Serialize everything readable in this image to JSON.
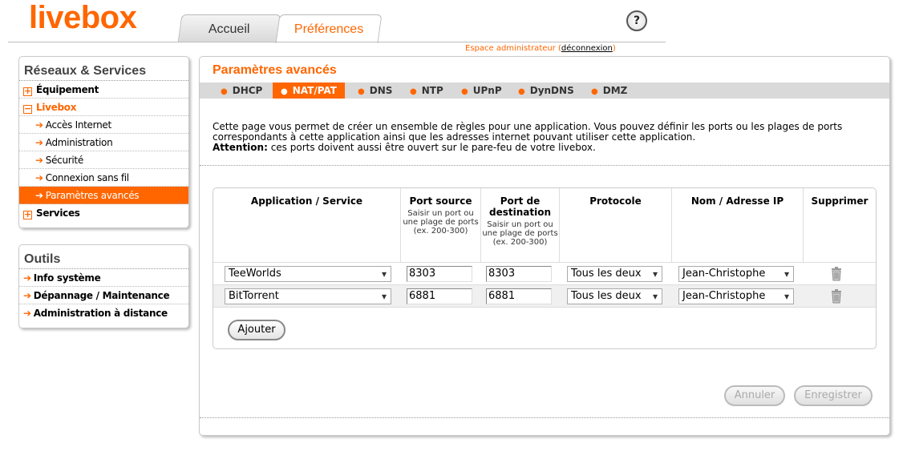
{
  "header": {
    "logo": "livebox",
    "tabs": [
      {
        "label": "Accueil"
      },
      {
        "label": "Préférences"
      }
    ],
    "help_symbol": "?",
    "admin_text": "Espace administrateur (",
    "logout_label": "déconnexion",
    "admin_close": ")"
  },
  "sidebar": {
    "title": "Réseaux & Services",
    "items": [
      {
        "label": "Équipement"
      },
      {
        "label": "Livebox"
      },
      {
        "label": "Accès Internet"
      },
      {
        "label": "Administration"
      },
      {
        "label": "Sécurité"
      },
      {
        "label": "Connexion sans fil"
      },
      {
        "label": "Paramètres avancés"
      },
      {
        "label": "Services"
      }
    ],
    "expand_symbol": "+",
    "collapse_symbol": "−",
    "arrow_symbol": "➔"
  },
  "tools": {
    "title": "Outils",
    "items": [
      {
        "label": "Info système"
      },
      {
        "label": "Dépannage / Maintenance"
      },
      {
        "label": "Administration à distance"
      }
    ]
  },
  "main": {
    "title": "Paramètres avancés",
    "subtabs": [
      {
        "label": "DHCP"
      },
      {
        "label": "NAT/PAT"
      },
      {
        "label": "DNS"
      },
      {
        "label": "NTP"
      },
      {
        "label": "UPnP"
      },
      {
        "label": "DynDNS"
      },
      {
        "label": "DMZ"
      }
    ],
    "bullet": "●",
    "intro_line1": "Cette page vous permet de créer un ensemble de règles pour une application. Vous pouvez définir les ports ou les plages de ports correspondants à cette application ainsi que les adresses internet pouvant utiliser cette application.",
    "attention_label": "Attention:",
    "attention_text": " ces ports doivent aussi être ouvert sur le pare-feu de votre livebox."
  },
  "table": {
    "headers": {
      "app": "Application / Service",
      "src": "Port source",
      "src_hint": "Saisir un port ou une plage de ports (ex. 200-300)",
      "dst": "Port de destination",
      "dst_hint": "Saisir un port ou une plage de ports (ex. 200-300)",
      "proto": "Protocole",
      "ip": "Nom / Adresse IP",
      "del": "Supprimer"
    },
    "rows": [
      {
        "app": "TeeWorlds",
        "src": "8303",
        "dst": "8303",
        "proto": "Tous les deux",
        "ip": "Jean-Christophe"
      },
      {
        "app": "BitTorrent",
        "src": "6881",
        "dst": "6881",
        "proto": "Tous les deux",
        "ip": "Jean-Christophe"
      }
    ],
    "add_label": "Ajouter"
  },
  "actions": {
    "cancel_label": "Annuler",
    "save_label": "Enregistrer"
  },
  "colors": {
    "accent": "#ff6600"
  }
}
